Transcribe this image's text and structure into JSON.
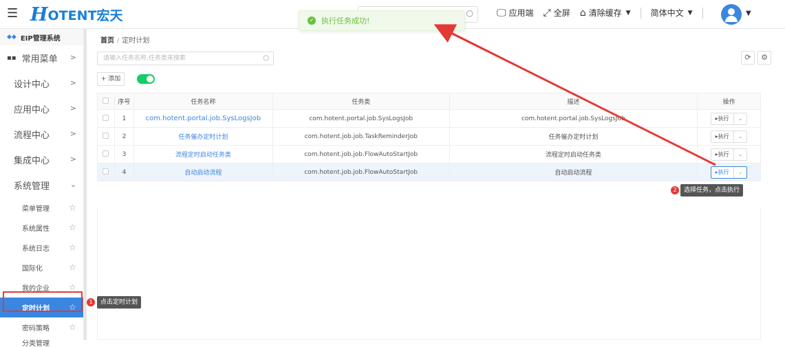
{
  "header": {
    "logo_mark": "H",
    "logo_text": "OTENT宏天",
    "toast": "执行任务成功!",
    "toolbar": [
      "应用端",
      "全屏",
      "清除缓存",
      "简体中文"
    ]
  },
  "sidebar": {
    "system_name": "EIP管理系统",
    "menus": [
      "常用菜单",
      "设计中心",
      "应用中心",
      "流程中心",
      "集成中心",
      "系统管理"
    ],
    "sub_items": [
      "菜单管理",
      "系统属性",
      "系统日志",
      "国际化",
      "我的企业",
      "定时计划",
      "密码策略",
      "分类管理"
    ]
  },
  "main": {
    "breadcrumb_home": "首页",
    "breadcrumb_current": "定时计划",
    "search_placeholder": "请输入任务名称,任务类来搜索",
    "add_label": "+ 添加",
    "columns": [
      "序号",
      "任务名称",
      "任务类",
      "描述",
      "操作"
    ],
    "rows": [
      {
        "idx": "1",
        "name": "com.hotent.portal.job.SysLogsJob",
        "cls": "com.hotent.portal.job.SysLogsJob",
        "desc": "com.hotent.portal.job.SysLogsJob"
      },
      {
        "idx": "2",
        "name": "任务催办定时计划",
        "cls": "com.hotent.job.job.TaskReminderJob",
        "desc": "任务催办定时计划"
      },
      {
        "idx": "3",
        "name": "流程定时启动任务类",
        "cls": "com.hotent.job.job.FlowAutoStartJob",
        "desc": "流程定时启动任务类"
      },
      {
        "idx": "4",
        "name": "自动启动流程",
        "cls": "com.hotent.job.job.FlowAutoStartJob",
        "desc": "自动启动流程"
      }
    ],
    "exec_label": "▸执行"
  },
  "annotations": {
    "tip1": "点击定时计划",
    "tip2": "选择任务，点击执行",
    "dot1": "1",
    "dot2": "2"
  }
}
